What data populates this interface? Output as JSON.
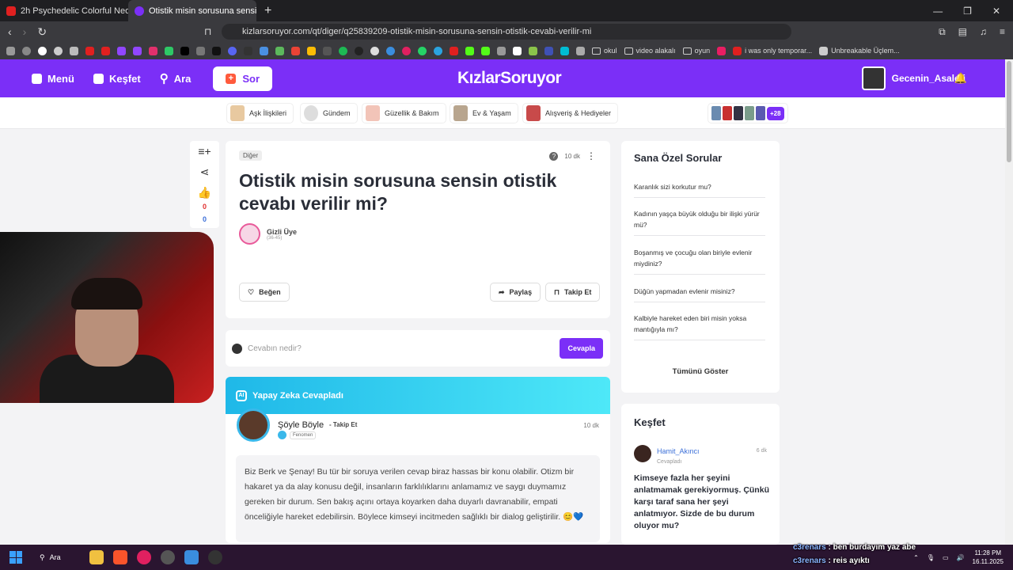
{
  "browser": {
    "tabs": [
      {
        "title": "2h Psychedelic Colorful Neon Backgro",
        "active": false,
        "color": "#e02020"
      },
      {
        "title": "Otistik misin sorusuna sensin otis",
        "active": true,
        "color": "#7b2ff7"
      }
    ],
    "url": "kizlarsoruyor.com/qt/diger/q25839209-otistik-misin-sorusuna-sensin-otistik-cevabi-verilir-mi",
    "bookmarks": [
      "okul",
      "video alakalı",
      "oyun",
      "i was only temporar...",
      "Unbreakable Üçlem..."
    ]
  },
  "site": {
    "logo": "KızlarSoruyor",
    "nav": {
      "menu": "Menü",
      "explore": "Keşfet",
      "search": "Ara",
      "ask": "Sor"
    },
    "username": "Gecenin_Asaleti",
    "brand_color": "#7b2ff7",
    "categories": [
      "Aşk İlişkileri",
      "Gündem",
      "Güzellik & Bakım",
      "Ev & Yaşam",
      "Alışveriş & Hediyeler"
    ],
    "more_count": "+28"
  },
  "question": {
    "tag": "Diğer",
    "time": "10 dk",
    "title": "Otistik misin sorusuna sensin otistik cevabı verilir mi?",
    "asker": "Gizli Üye",
    "age": "(36-45)",
    "like": "Beğen",
    "share": "Paylaş",
    "follow": "Takip Et",
    "likes": "0",
    "dislikes": "0"
  },
  "answer_box": {
    "placeholder": "Cevabın nedir?",
    "button": "Cevapla"
  },
  "ai_answer": {
    "header": "Yapay Zeka Cevapladı",
    "badge": "AI",
    "user": "Şöyle Böyle",
    "follow": "Takip Et",
    "rank": "Fenomen",
    "time": "10 dk",
    "text": "Biz Berk ve Şenay! Bu tür bir soruya verilen cevap biraz hassas bir konu olabilir. Otizm bir hakaret ya da alay konusu değil, insanların farklılıklarını anlamamız ve saygı duymamız gereken bir durum. Sen bakış açını ortaya koyarken daha duyarlı davranabilir, empati önceliğiyle hareket edebilirsin. Böylece kimseyi incitmeden sağlıklı bir dialog geliştirilir. 😊💙"
  },
  "suggested": {
    "title": "Sana Özel Sorular",
    "items": [
      "Karanlık sizi korkutur mu?",
      "Kadının yaşça büyük olduğu bir ilişki yürür mü?",
      "Boşanmış ve çocuğu olan biriyle evlenir miydiniz?",
      "Düğün yapmadan evlenir misiniz?",
      "Kalbiyle hareket eden biri misin yoksa mantığıyla mı?"
    ],
    "show_all": "Tümünü Göster"
  },
  "explore": {
    "title": "Keşfet",
    "user": "Hamit_Akıncı",
    "action": "Cevapladı",
    "time": "6 dk",
    "text": "Kimseye fazla her şeyini anlatmamak gerekiyormuş. Çünkü karşı taraf sana her şeyi anlatmıyor. Sizde de bu durum oluyor mu?"
  },
  "chat": [
    {
      "user": "c3renars",
      "msg": ": ben burdayım yaz abe"
    },
    {
      "user": "c3renars",
      "msg": ": reis ayıktı"
    }
  ],
  "taskbar": {
    "search": "Ara",
    "time": "11:28 PM",
    "date": "16.11.2025"
  }
}
